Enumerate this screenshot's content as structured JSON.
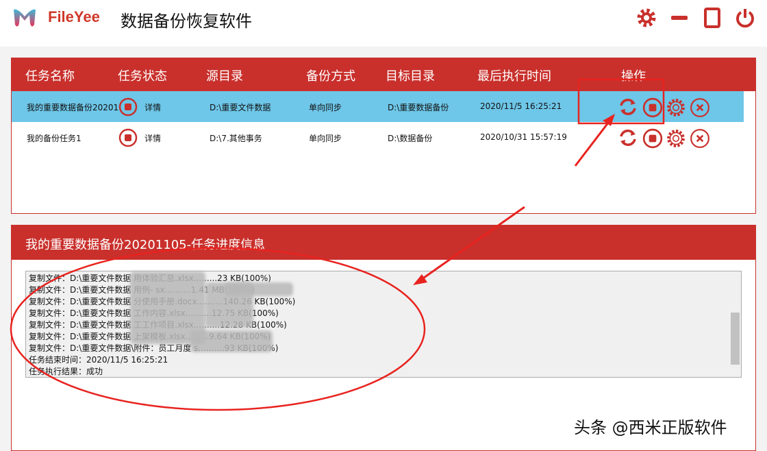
{
  "app": {
    "brand": "FileYee",
    "title": "数据备份恢复软件"
  },
  "colors": {
    "accent": "#c9302c",
    "selected_row": "#6ec6e8"
  },
  "window_buttons": [
    "settings-icon",
    "minimize-icon",
    "maximize-icon",
    "power-icon"
  ],
  "table": {
    "headers": [
      "任务名称",
      "任务状态",
      "源目录",
      "备份方式",
      "目标目录",
      "最后执行时间",
      "操作"
    ],
    "rows": [
      {
        "name": "我的重要数据备份20201",
        "detail": "详情",
        "source": "D:\\重要文件数据",
        "mode": "单向同步",
        "target": "D:\\重要数据备份",
        "last_run": "2020/11/5 16:25:21"
      },
      {
        "name": "我的备份任务1",
        "detail": "详情",
        "source": "D:\\7.其他事务",
        "mode": "单向同步",
        "target": "D:\\数据备份",
        "last_run": "2020/10/31 15:57:19"
      }
    ]
  },
  "progress": {
    "title": "我的重要数据备份20201105-任务进度信息",
    "lines": [
      "复制文件：D:\\重要文件数据                              用体验汇总.xlsx.........23 KB(100%)",
      "复制文件：D:\\重要文件数据                              用例-                              sx..........1.41 MB(100%)",
      "复制文件：D:\\重要文件数据              分使用手册.docx..........140.26 KB(100%)",
      "复制文件：D:\\重要文件数据                        工作内容.xlsx..........12.75 KB(100%)",
      "复制文件：D:\\重要文件数据                                工工作项目.xlsx..........12.28 KB(100%)",
      "复制文件：D:\\重要文件数据                              上架模板.xlsx.........9.64 KB(100%)",
      "复制文件：D:\\重要文件数据\\附件：员工月度                         s..........93 KB(100%)",
      "任务结束时间：2020/11/5 16:25:21",
      "任务执行结果：成功"
    ]
  },
  "watermark": "头条 @西米正版软件"
}
